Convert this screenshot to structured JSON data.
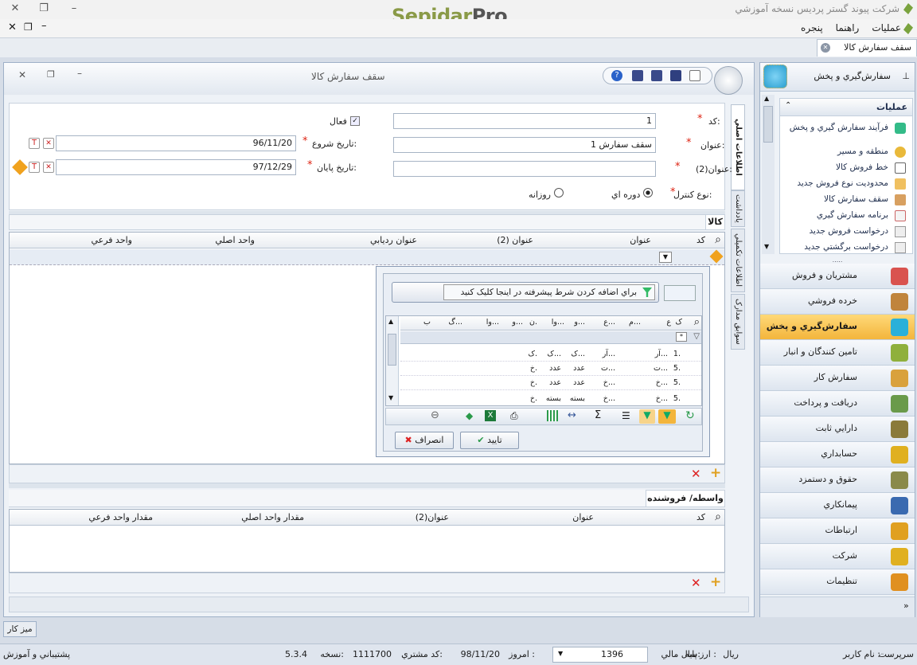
{
  "app": {
    "title": "شرکت پیوند گستر پردیس نسخه آموزشي",
    "logo_a": "Sepidar",
    "logo_b": "Pro"
  },
  "menu": [
    "پنجره",
    "راهنما",
    "عمليات"
  ],
  "doc_tab": "سقف سفارش کالا",
  "window": {
    "title": "سقف سفارش کالا"
  },
  "form": {
    "code_label": "کد:",
    "code_value": "1",
    "title_label": "عنوان:",
    "title_value": "سقف سفارش 1",
    "title2_label": "عنوان(2):",
    "title2_value": "",
    "active_label": "فعال",
    "start_label": "تاريخ شروع:",
    "start_value": "96/11/20",
    "end_label": "تاريخ پايان:",
    "end_value": "97/12/29",
    "control_label": "نوع کنترل:",
    "opt_period": "دوره اي",
    "opt_daily": "روزانه"
  },
  "side_tabs": [
    "اطلاعات اصلي",
    "يادداشت",
    "اطلاعات تکميلي",
    "سوابق مدارک"
  ],
  "goods": {
    "tab": "کالا",
    "columns": [
      "کد",
      "عنوان",
      "عنوان (2)",
      "عنوان رديابي",
      "واحد اصلي",
      "واحد فرعي"
    ]
  },
  "popup": {
    "filter_hint": "براي اضافه کردن شرط پيشرفته در اينجا کليک کنيد",
    "columns": [
      "ک",
      "ع",
      "م...",
      "ع...",
      "و...",
      "وا...",
      "ن.",
      "و...",
      "وا...",
      "گ...",
      "ب"
    ],
    "rows": [
      [
        "1.",
        "آر...",
        "",
        "آر...",
        "ک...",
        "ک...",
        "ک."
      ],
      [
        "5.",
        "ت...",
        "",
        "ت...",
        "عدد",
        "عدد",
        "خ."
      ],
      [
        "5.",
        "خ...",
        "",
        "خ...",
        "عدد",
        "عدد",
        "خ."
      ],
      [
        "5.",
        "خ...",
        "",
        "خ...",
        "بسته",
        "بسته",
        "خ."
      ]
    ],
    "ok": "تاييد",
    "cancel": "انصراف"
  },
  "vendor": {
    "tab": "واسطه/ فروشنده",
    "columns": [
      "کد",
      "عنوان",
      "عنوان(2)",
      "مقدار واحد اصلي",
      "مقدار واحد فرعي"
    ]
  },
  "nav": {
    "header": "سفارش‌گيري و پخش",
    "ops_title": "عمليات",
    "ops": [
      "فرآيند سفارش گيري و پخش",
      "منطقه و مسير",
      "خط فروش کالا",
      "محدوديت نوع فروش جديد",
      "سقف سفارش کالا",
      "برنامه سفارش گيري",
      "درخواست فروش جديد",
      "درخواست برگشتي جديد"
    ],
    "modules": [
      "مشتريان و فروش",
      "خرده فروشي",
      "سفارش‌گيري و پخش",
      "تامين کنندگان و انبار",
      "سفارش کار",
      "دريافت و پرداخت",
      "دارايي ثابت",
      "حسابداري",
      "حقوق و دستمزد",
      "پيمانکاري",
      "ارتباطات",
      "شرکت",
      "تنظيمات"
    ],
    "active_index": 2
  },
  "desk": "ميز کار",
  "status": {
    "user_label": "نام کاربر :",
    "user": "سرپرست",
    "currency_label": "ارز پايه :",
    "currency": "ريال",
    "fy_label": "سال مالي:",
    "fy": "1396",
    "today_label": "امروز :",
    "today": "98/11/20",
    "cust_label": "کد مشتري:",
    "cust": "1111700",
    "ver_label": "نسخه:",
    "ver": "5.3.4",
    "support": "پشتيباني و آموزش"
  },
  "colors": {
    "accent": "#f3b53c",
    "logo_green": "#8a9a47",
    "required": "#dd2211"
  }
}
